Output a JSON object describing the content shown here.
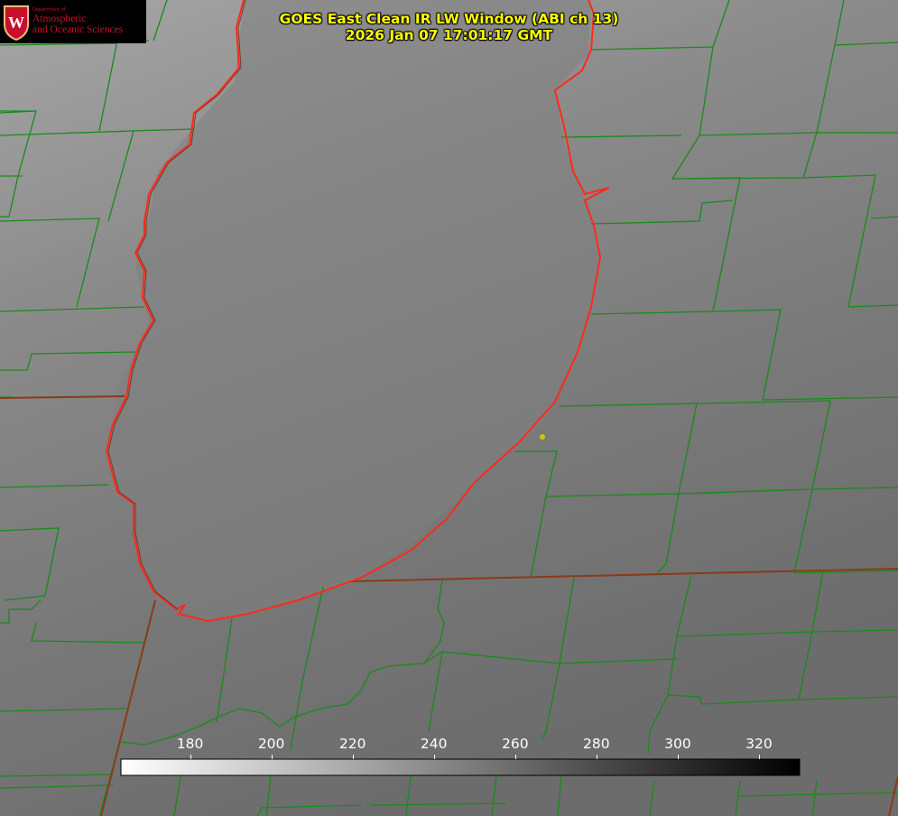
{
  "header": {
    "title_line1": "GOES East Clean IR LW Window (ABI ch 13)",
    "title_line2": "2026 Jan 07 17:01:17 GMT"
  },
  "logo": {
    "department": "Department of",
    "line1": "Atmospheric",
    "line2": "and Oceanic Sciences",
    "crest_letter": "W"
  },
  "colorbar": {
    "min": 163,
    "max": 330,
    "ticks": [
      "180",
      "200",
      "220",
      "240",
      "260",
      "280",
      "300",
      "320"
    ],
    "tick_values": [
      180,
      200,
      220,
      240,
      260,
      280,
      300,
      320
    ],
    "colors": [
      "#ffffff",
      "#000000"
    ]
  },
  "colors": {
    "coastline": "#ff2a1a",
    "county_lines": "#1a8a1a",
    "state_lines": "#8a3a1a",
    "title": "#ffff00",
    "marker": "#d4c400"
  }
}
